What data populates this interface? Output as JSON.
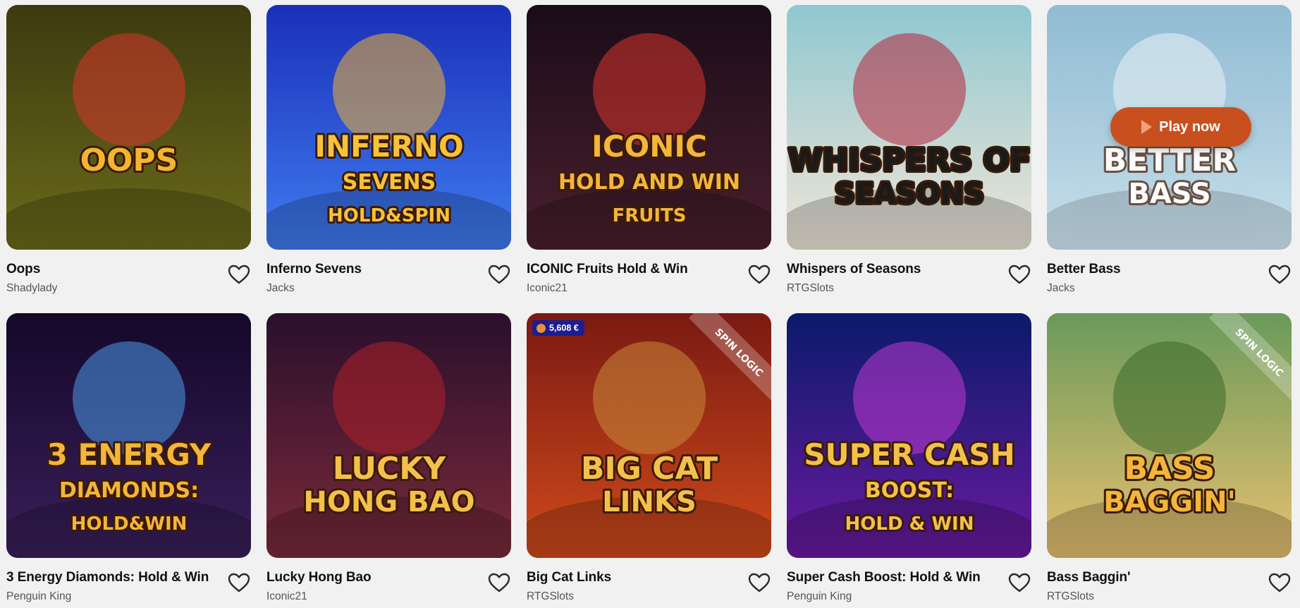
{
  "colors": {
    "background": "#f1f1f1",
    "title": "#111111",
    "provider": "#555555",
    "play_button": "#c8501e"
  },
  "games": [
    {
      "title": "Oops",
      "provider": "Shadylady",
      "art_text": [
        "OOPS"
      ],
      "bg": [
        "#3c3a10",
        "#6b6a1a"
      ],
      "accent": "#d9342b",
      "text_color": "#f3b530"
    },
    {
      "title": "Inferno Sevens",
      "provider": "Jacks",
      "art_text": [
        "INFERNO",
        "SEVENS",
        "HOLD&SPIN"
      ],
      "bg": [
        "#1a2fb8",
        "#3f7cf0"
      ],
      "accent": "#f2b233",
      "text_color": "#f7c23a"
    },
    {
      "title": "ICONIC Fruits Hold & Win",
      "provider": "Iconic21",
      "art_text": [
        "ICONIC",
        "HOLD AND WIN",
        "FRUITS"
      ],
      "bg": [
        "#1a0c18",
        "#4a1f2e"
      ],
      "accent": "#d9342b",
      "text_color": "#f3b53a"
    },
    {
      "title": "Whispers of Seasons",
      "provider": "RTGSlots",
      "art_text": [
        "WHISPERS OF",
        "SEASONS"
      ],
      "bg": [
        "#8fc7d0",
        "#f0e6d8"
      ],
      "accent": "#b4253a",
      "text_color": "#1a1a1a"
    },
    {
      "title": "Better Bass",
      "provider": "Jacks",
      "art_text": [
        "BETTER",
        "BASS"
      ],
      "bg": [
        "#6fa9c8",
        "#b9d9e8"
      ],
      "accent": "#e9f3f8",
      "text_color": "#ffffff",
      "play_label": "Play now"
    },
    {
      "title": "3 Energy Diamonds: Hold & Win",
      "provider": "Penguin King",
      "art_text": [
        "3 ENERGY",
        "DIAMONDS:",
        "HOLD&WIN"
      ],
      "bg": [
        "#14082a",
        "#3a1f5a"
      ],
      "accent": "#4a9be8",
      "text_color": "#f3b53a"
    },
    {
      "title": "Lucky Hong Bao",
      "provider": "Iconic21",
      "art_text": [
        "LUCKY",
        "HONG BAO"
      ],
      "bg": [
        "#2a0f2c",
        "#7a2a3a"
      ],
      "accent": "#b1202a",
      "text_color": "#f3c04a"
    },
    {
      "title": "Big Cat Links",
      "provider": "RTGSlots",
      "art_text": [
        "BIG CAT",
        "LINKS",
        "SPIN LOGIC"
      ],
      "bg": [
        "#7a1a12",
        "#d04a1a"
      ],
      "accent": "#c88a3a",
      "text_color": "#f3c04a",
      "jackpot": "5,608 €"
    },
    {
      "title": "Super Cash Boost: Hold & Win",
      "provider": "Penguin King",
      "art_text": [
        "SUPER CASH",
        "BOOST:",
        "HOLD & WIN"
      ],
      "bg": [
        "#0a1a6a",
        "#6a1aa0"
      ],
      "accent": "#c03ad0",
      "text_color": "#f3c04a"
    },
    {
      "title": "Bass Baggin'",
      "provider": "RTGSlots",
      "art_text": [
        "BASS",
        "BAGGIN'",
        "SPIN LOGIC"
      ],
      "bg": [
        "#6a9a5a",
        "#e8c070"
      ],
      "accent": "#3a6a2a",
      "text_color": "#f3b53a"
    }
  ]
}
